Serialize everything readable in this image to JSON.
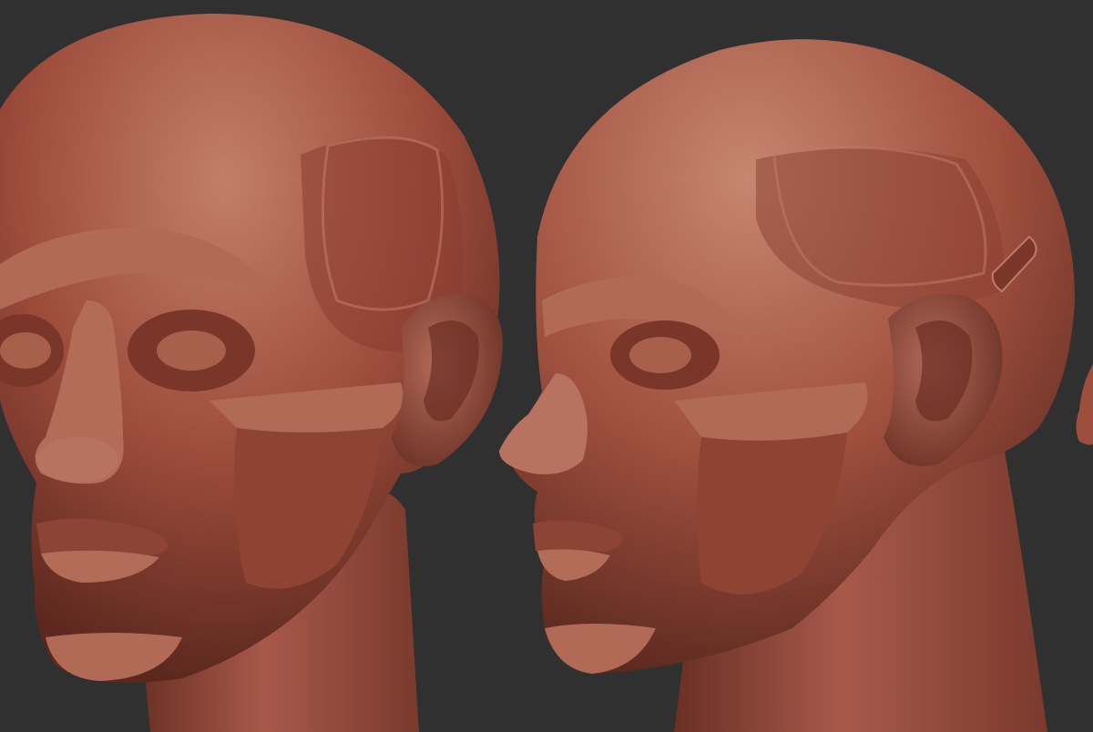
{
  "scene": {
    "background_color": "#303030",
    "clay_color": "#9b4a3a",
    "clay_highlight": "#c98a74",
    "clay_shadow": "#5e2a20",
    "subjects": [
      {
        "icon": "ecorche-head-three-quarter-left"
      },
      {
        "icon": "ecorche-head-three-quarter-right"
      },
      {
        "icon": "ecorche-head-partial-edge"
      }
    ]
  }
}
